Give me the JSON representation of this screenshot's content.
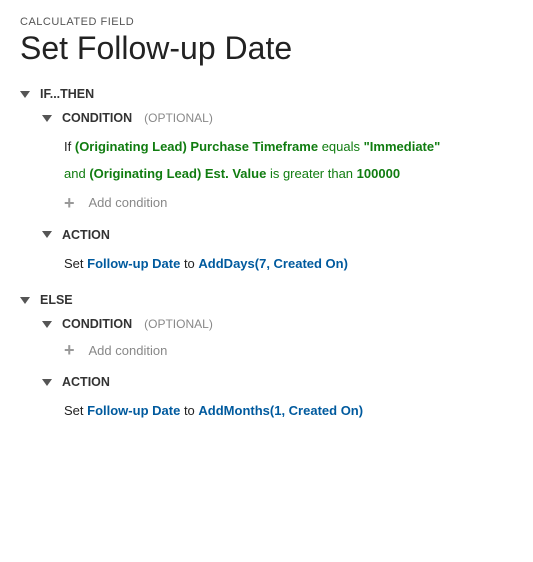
{
  "header": {
    "label": "CALCULATED FIELD",
    "title": "Set Follow-up Date"
  },
  "if_then": {
    "label": "IF...THEN",
    "condition": {
      "label": "CONDITION",
      "optional": "(OPTIONAL)",
      "line1": {
        "prefix": "If",
        "field": "(Originating Lead) Purchase Timeframe",
        "op": "equals",
        "value": "\"Immediate\""
      },
      "line2": {
        "prefix": "and",
        "field": "(Originating Lead) Est. Value",
        "op": "is greater than",
        "value": "100000"
      },
      "add": "Add condition"
    },
    "action": {
      "label": "ACTION",
      "line": {
        "prefix": "Set",
        "field": "Follow-up Date",
        "to": "to",
        "func": "AddDays(7, Created On)"
      }
    }
  },
  "else": {
    "label": "ELSE",
    "condition": {
      "label": "CONDITION",
      "optional": "(OPTIONAL)",
      "add": "Add condition"
    },
    "action": {
      "label": "ACTION",
      "line": {
        "prefix": "Set",
        "field": "Follow-up Date",
        "to": "to",
        "func": "AddMonths(1, Created On)"
      }
    }
  }
}
